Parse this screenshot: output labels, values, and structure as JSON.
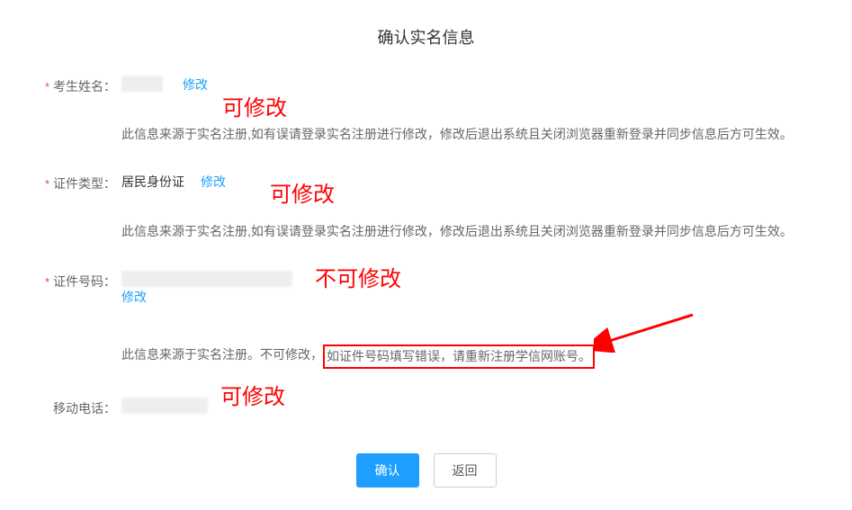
{
  "title": "确认实名信息",
  "fields": {
    "name": {
      "label": "考生姓名：",
      "modify": "修改",
      "hint": "此信息来源于实名注册,如有误请登录实名注册进行修改，修改后退出系统且关闭浏览器重新登录并同步信息后方可生效。",
      "annotation": "可修改"
    },
    "idtype": {
      "label": "证件类型：",
      "value": "居民身份证",
      "modify": "修改",
      "hint": "此信息来源于实名注册,如有误请登录实名注册进行修改，修改后退出系统且关闭浏览器重新登录并同步信息后方可生效。",
      "annotation": "可修改"
    },
    "idnum": {
      "label": "证件号码：",
      "modify": "修改",
      "hint_prefix": "此信息来源于实名注册。不可修改",
      "hint_boxed": "如证件号码填写错误，请重新注册学信网账号。",
      "annotation": "不可修改"
    },
    "phone": {
      "label": "移动电话：",
      "annotation": "可修改"
    }
  },
  "buttons": {
    "confirm": "确认",
    "back": "返回"
  }
}
